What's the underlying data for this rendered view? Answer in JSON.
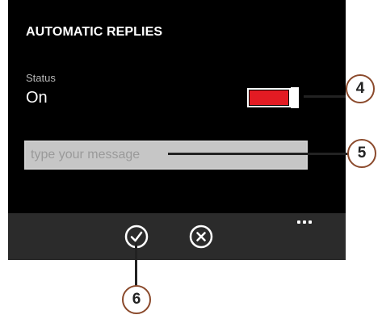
{
  "header": {
    "title": "AUTOMATIC REPLIES"
  },
  "status": {
    "label": "Status",
    "value": "On",
    "toggle_on": true,
    "toggle_color": "#e31b23"
  },
  "message": {
    "placeholder": "type your message",
    "value": ""
  },
  "appbar": {
    "buttons": [
      {
        "icon": "check-icon",
        "meaning": "save"
      },
      {
        "icon": "close-icon",
        "meaning": "cancel"
      }
    ],
    "more_label": "..."
  },
  "callouts": [
    "4",
    "5",
    "6"
  ],
  "colors": {
    "background": "#000000",
    "appbar": "#2b2b2b",
    "callout_border": "#8b4a2c"
  }
}
